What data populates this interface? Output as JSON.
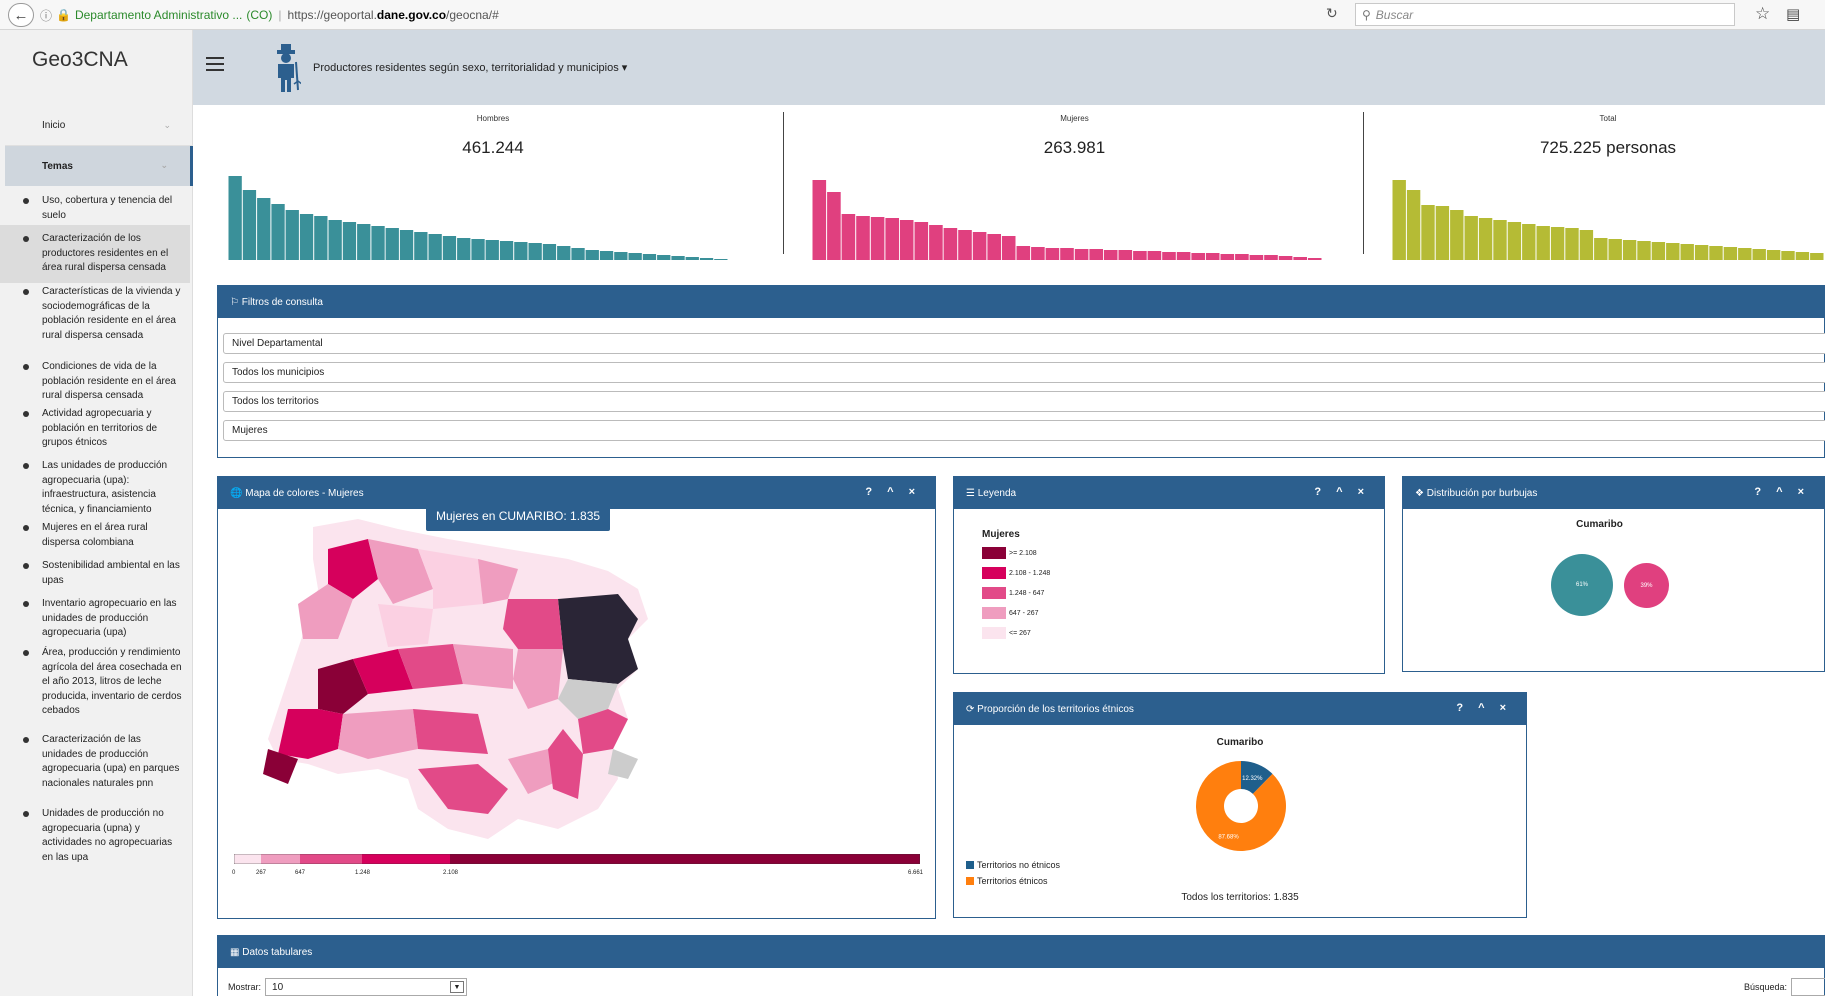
{
  "browser": {
    "site_name": "Departamento Administrativo ...",
    "country": "(CO)",
    "url_prefix": "https://geoportal.",
    "url_domain": "dane.gov.co",
    "url_suffix": "/geocna/#",
    "search_placeholder": "Buscar"
  },
  "sidebar": {
    "brand": "Geo3CNA",
    "inicio": "Inicio",
    "temas": "Temas",
    "topics": [
      "Uso, cobertura y tenencia del suelo",
      "Caracterización de los productores residentes en el área rural dispersa censada",
      "Características de la vivienda y sociodemográficas de la población residente en el área rural dispersa censada",
      "Condiciones de vida de la población residente en el área rural dispersa censada",
      "Actividad agropecuaria y población en territorios de grupos étnicos",
      "Las unidades de producción agropecuaria (upa): infraestructura, asistencia técnica, y financiamiento",
      "Mujeres en el área rural dispersa colombiana",
      "Sostenibilidad ambiental en las upas",
      "Inventario agropecuario en las unidades de producción agropecuaria (upa)",
      "Área, producción y rendimiento agrícola del área cosechada en el año 2013, litros de leche producida, inventario de cerdos cebados",
      "Caracterización de las unidades de producción agropecuaria (upa) en parques nacionales naturales  pnn",
      "Unidades de producción no agropecuaria (upna) y actividades no agropecuarias en las upa"
    ]
  },
  "header": {
    "title": "Productores residentes según sexo, territorialidad y municipios",
    "caret": "▾"
  },
  "stats": {
    "hombres": {
      "label": "Hombres",
      "value": "461.244",
      "color": "#3a9099"
    },
    "mujeres": {
      "label": "Mujeres",
      "value": "263.981",
      "color": "#e0407f"
    },
    "total": {
      "label": "Total",
      "value": "725.225 personas",
      "color": "#b5bb35"
    }
  },
  "filtros": {
    "title": "Filtros de consulta",
    "fields": [
      "Nivel Departamental",
      "Todos los municipios",
      "Todos los territorios",
      "Mujeres"
    ]
  },
  "mapa": {
    "title": "Mapa de colores - Mujeres",
    "tooltip": "Mujeres en CUMARIBO: 1.835",
    "controls": "? ^ ×",
    "scale": [
      "0",
      "267",
      "647",
      "1.248",
      "2.108",
      "6.661"
    ]
  },
  "leyenda": {
    "title": "Leyenda",
    "heading": "Mujeres",
    "items": [
      {
        "label": ">= 2.108",
        "color": "#8a0037"
      },
      {
        "label": "2.108 - 1.248",
        "color": "#d6005c"
      },
      {
        "label": "1.248 - 647",
        "color": "#e24a88"
      },
      {
        "label": "647 - 267",
        "color": "#ef9dbf"
      },
      {
        "label": "<= 267",
        "color": "#fbe4ee"
      }
    ]
  },
  "burbujas": {
    "title": "Distribución por burbujas",
    "chart_title": "Cumaribo",
    "b1": "61%",
    "b2": "39%"
  },
  "proporcion": {
    "title": "Proporción de los territorios étnicos",
    "chart_title": "Cumaribo",
    "pct_no_etnicos": "12.32%",
    "pct_etnicos": "87.68%",
    "legend_no_etnicos": "Territorios no étnicos",
    "legend_etnicos": "Territorios étnicos",
    "total": "Todos los territorios: 1.835"
  },
  "chart_data": {
    "type": "pie",
    "title": "Cumaribo",
    "categories": [
      "Territorios no étnicos",
      "Territorios étnicos"
    ],
    "values": [
      12.32,
      87.68
    ],
    "colors": [
      "#1f5f8c",
      "#ff7f0e"
    ]
  },
  "tabulares": {
    "title": "Datos tabulares",
    "mostrar_label": "Mostrar:",
    "mostrar_value": "10",
    "busqueda_label": "Búsqueda:"
  }
}
